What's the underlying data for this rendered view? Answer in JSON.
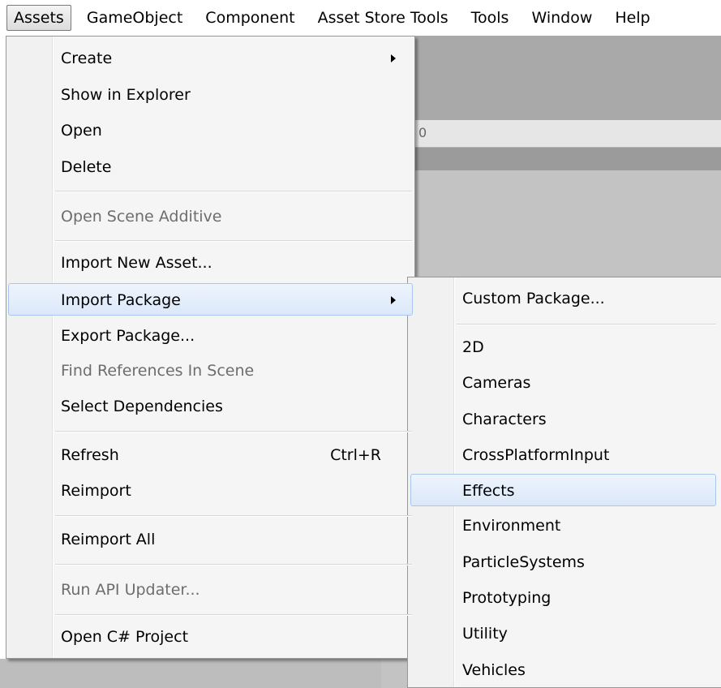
{
  "menubar": {
    "items": [
      {
        "label": "Assets",
        "active": true
      },
      {
        "label": "GameObject"
      },
      {
        "label": "Component"
      },
      {
        "label": "Asset Store Tools"
      },
      {
        "label": "Tools"
      },
      {
        "label": "Window"
      },
      {
        "label": "Help"
      }
    ]
  },
  "background": {
    "tab_fragment": "0"
  },
  "assets_menu": {
    "items": [
      {
        "label": "Create",
        "submenu": true
      },
      {
        "label": "Show in Explorer"
      },
      {
        "label": "Open"
      },
      {
        "label": "Delete"
      },
      {
        "label": "Open Scene Additive",
        "disabled": true
      },
      {
        "label": "Import New Asset..."
      },
      {
        "label": "Import Package",
        "submenu": true,
        "highlighted": true
      },
      {
        "label": "Export Package..."
      },
      {
        "label": "Find References In Scene",
        "disabled": true
      },
      {
        "label": "Select Dependencies"
      },
      {
        "label": "Refresh",
        "shortcut": "Ctrl+R"
      },
      {
        "label": "Reimport"
      },
      {
        "label": "Reimport All"
      },
      {
        "label": "Run API Updater...",
        "disabled": true
      },
      {
        "label": "Open C# Project"
      }
    ]
  },
  "import_package_menu": {
    "items": [
      {
        "label": "Custom Package..."
      },
      {
        "label": "2D"
      },
      {
        "label": "Cameras"
      },
      {
        "label": "Characters"
      },
      {
        "label": "CrossPlatformInput"
      },
      {
        "label": "Effects",
        "highlighted": true
      },
      {
        "label": "Environment"
      },
      {
        "label": "ParticleSystems"
      },
      {
        "label": "Prototyping"
      },
      {
        "label": "Utility"
      },
      {
        "label": "Vehicles"
      }
    ]
  },
  "colors": {
    "highlight_border": "#a9c7ee",
    "highlight_fill": "#dbe8f9",
    "disabled_text": "#6d6d6d",
    "menu_background": "#f5f5f5"
  }
}
